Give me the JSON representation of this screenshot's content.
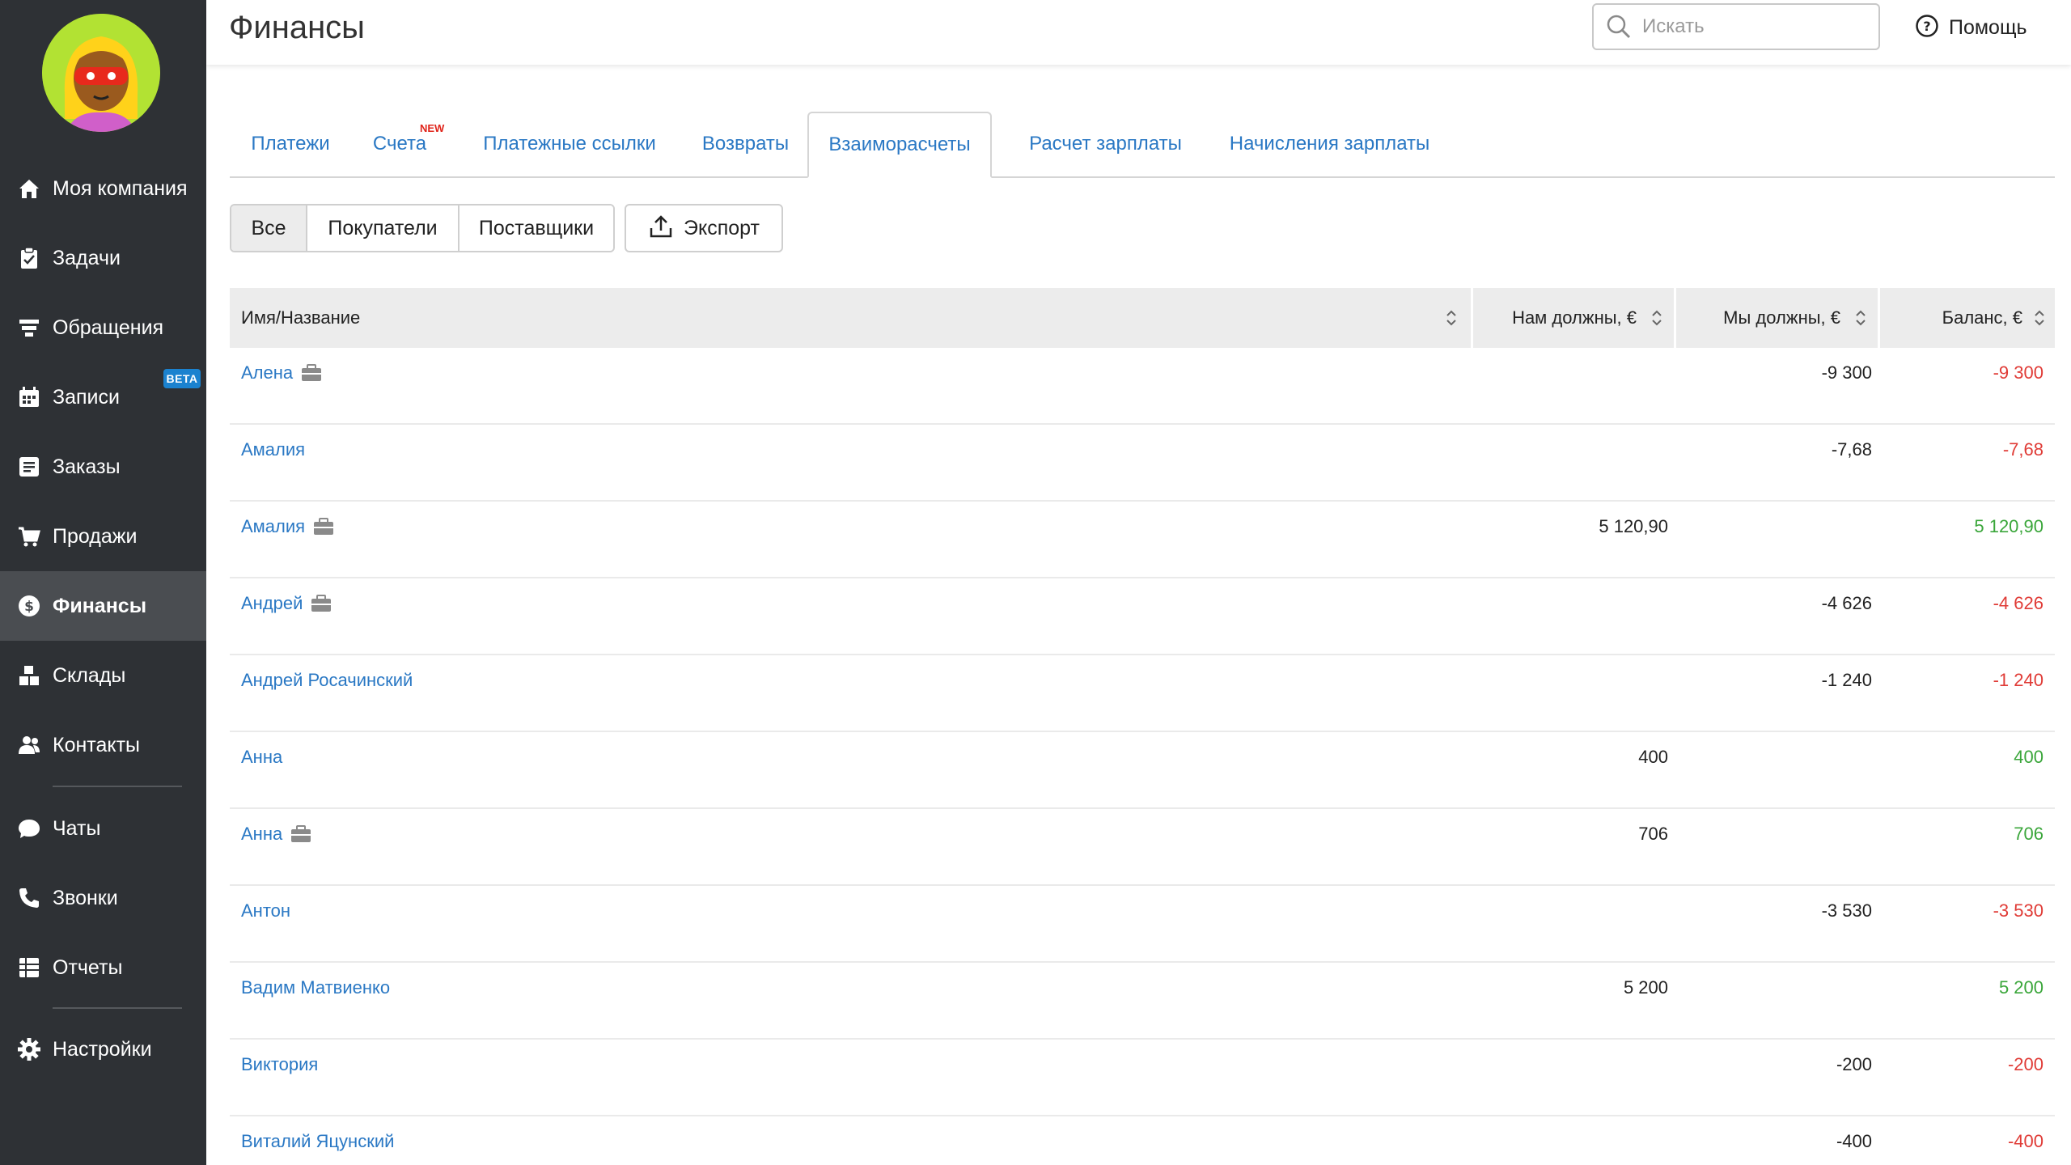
{
  "sidebar": {
    "items": [
      {
        "label": "Моя компания",
        "icon": "home-icon"
      },
      {
        "label": "Задачи",
        "icon": "clipboard-icon"
      },
      {
        "label": "Обращения",
        "icon": "funnel-icon"
      },
      {
        "label": "Записи",
        "icon": "calendar-icon",
        "badge": "BETA"
      },
      {
        "label": "Заказы",
        "icon": "order-list-icon"
      },
      {
        "label": "Продажи",
        "icon": "cart-icon"
      },
      {
        "label": "Финансы",
        "icon": "dollar-coin-icon",
        "active": true
      },
      {
        "label": "Склады",
        "icon": "boxes-icon"
      },
      {
        "label": "Контакты",
        "icon": "people-icon"
      },
      {
        "label": "Чаты",
        "icon": "chat-bubble-icon"
      },
      {
        "label": "Звонки",
        "icon": "phone-icon"
      },
      {
        "label": "Отчеты",
        "icon": "table-icon"
      },
      {
        "label": "Настройки",
        "icon": "gear-icon"
      }
    ]
  },
  "header": {
    "title": "Финансы",
    "search_placeholder": "Искать",
    "help_label": "Помощь"
  },
  "tabs": [
    {
      "label": "Платежи"
    },
    {
      "label": "Счета",
      "badge": "NEW"
    },
    {
      "label": "Платежные ссылки"
    },
    {
      "label": "Возвраты"
    },
    {
      "label": "Взаиморасчеты",
      "active": true
    },
    {
      "label": "Расчет зарплаты"
    },
    {
      "label": "Начисления зарплаты"
    }
  ],
  "filters": {
    "segments": [
      {
        "label": "Все",
        "active": true
      },
      {
        "label": "Покупатели"
      },
      {
        "label": "Поставщики"
      }
    ],
    "export_label": "Экспорт"
  },
  "table": {
    "columns": [
      "Имя/Название",
      "Нам должны, €",
      "Мы должны, €",
      "Баланс, €"
    ],
    "rows": [
      {
        "name": "Алена",
        "company": true,
        "owed_to_us": "",
        "we_owe": "-9 300",
        "balance": "-9 300",
        "balance_sign": "neg"
      },
      {
        "name": "Амалия",
        "company": false,
        "owed_to_us": "",
        "we_owe": "-7,68",
        "balance": "-7,68",
        "balance_sign": "neg"
      },
      {
        "name": "Амалия",
        "company": true,
        "owed_to_us": "5 120,90",
        "we_owe": "",
        "balance": "5 120,90",
        "balance_sign": "pos"
      },
      {
        "name": "Андрей",
        "company": true,
        "owed_to_us": "",
        "we_owe": "-4 626",
        "balance": "-4 626",
        "balance_sign": "neg"
      },
      {
        "name": "Андрей Росачинский",
        "company": false,
        "owed_to_us": "",
        "we_owe": "-1 240",
        "balance": "-1 240",
        "balance_sign": "neg"
      },
      {
        "name": "Анна",
        "company": false,
        "owed_to_us": "400",
        "we_owe": "",
        "balance": "400",
        "balance_sign": "pos"
      },
      {
        "name": "Анна",
        "company": true,
        "owed_to_us": "706",
        "we_owe": "",
        "balance": "706",
        "balance_sign": "pos"
      },
      {
        "name": "Антон",
        "company": false,
        "owed_to_us": "",
        "we_owe": "-3 530",
        "balance": "-3 530",
        "balance_sign": "neg"
      },
      {
        "name": "Вадим Матвиенко",
        "company": false,
        "owed_to_us": "5 200",
        "we_owe": "",
        "balance": "5 200",
        "balance_sign": "pos"
      },
      {
        "name": "Виктория",
        "company": false,
        "owed_to_us": "",
        "we_owe": "-200",
        "balance": "-200",
        "balance_sign": "neg"
      },
      {
        "name": "Виталий Яцунский",
        "company": false,
        "owed_to_us": "",
        "we_owe": "-400",
        "balance": "-400",
        "balance_sign": "neg"
      }
    ]
  },
  "colors": {
    "sidebar_bg": "#2e3135",
    "sidebar_active": "#4a4d51",
    "link": "#2a78c4",
    "negative": "#e03b36",
    "positive": "#3aa63a"
  }
}
